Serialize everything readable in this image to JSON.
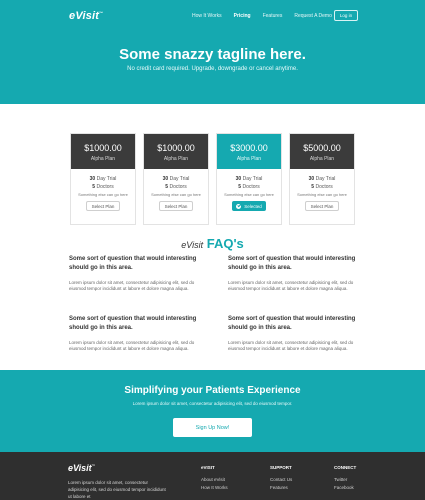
{
  "header": {
    "logo": "eVisit",
    "logo_mark": "™",
    "nav": [
      "How It Works",
      "Pricing",
      "Features",
      "Request A Demo"
    ],
    "active_nav": "Pricing",
    "login_label": "Log in",
    "tagline": "Some snazzy tagline here.",
    "subtagline": "No credit card required. Upgrade, downgrade or cancel anytime.",
    "bg_color": "#15a9b0"
  },
  "plans": [
    {
      "price": "$1000.00",
      "name": "Alpha Plan",
      "trial_num": "30",
      "trial_text": "Day Trial",
      "doctors_num": "5",
      "doctors_text": "Doctors",
      "note": "Something else can go here",
      "button": "Select Plan",
      "featured": false
    },
    {
      "price": "$1000.00",
      "name": "Alpha Plan",
      "trial_num": "30",
      "trial_text": "Day Trial",
      "doctors_num": "5",
      "doctors_text": "Doctors",
      "note": "Something else can go here",
      "button": "Select Plan",
      "featured": false
    },
    {
      "price": "$3000.00",
      "name": "Alpha Plan",
      "trial_num": "30",
      "trial_text": "Day Trial",
      "doctors_num": "5",
      "doctors_text": "Doctors",
      "note": "Something else can go here",
      "button": "Selected",
      "featured": true
    },
    {
      "price": "$5000.00",
      "name": "Alpha Plan",
      "trial_num": "30",
      "trial_text": "Day Trial",
      "doctors_num": "5",
      "doctors_text": "Doctors",
      "note": "Something else can go here",
      "button": "Select Plan",
      "featured": false
    }
  ],
  "faq": {
    "brand": "eVisit",
    "title": "FAQ's",
    "items": [
      {
        "question": "Some sort of question that would interesting should go in this area.",
        "answer": "Lorem ipsum dolor sit amet, consectetur adipisicing elit, sed do eiusmod tempor incididunt ut labore et dolore magna aliqua."
      },
      {
        "question": "Some sort of question that would interesting should go in this area.",
        "answer": "Lorem ipsum dolor sit amet, consectetur adipisicing elit, sed do eiusmod tempor incididunt ut labore et dolore magna aliqua."
      },
      {
        "question": "Some sort of question that would interesting should go in this area.",
        "answer": "Lorem ipsum dolor sit amet, consectetur adipisicing elit, sed do eiusmod tempor incididunt ut labore et dolore magna aliqua."
      },
      {
        "question": "Some sort of question that would interesting should go in this area.",
        "answer": "Lorem ipsum dolor sit amet, consectetur adipisicing elit, sed do eiusmod tempor incididunt ut labore et dolore magna aliqua."
      }
    ]
  },
  "cta": {
    "title": "Simplifying your Patients Experience",
    "text": "Lorem ipsum dolor sit amet, consectetur adipisicing elit, sed do eiusmod tempor.",
    "button": "Sign Up Now!"
  },
  "footer": {
    "logo": "eVisit",
    "about": "Lorem ipsum dolor sit amet, consectetur adipisicing elit, sed do eiusmod tempor incididunt ut labore et",
    "columns": [
      {
        "title": "eVISIT",
        "links": [
          "About eVisit",
          "How It Works"
        ]
      },
      {
        "title": "SUPPORT",
        "links": [
          "Contact Us",
          "Features"
        ]
      },
      {
        "title": "CONNECT",
        "links": [
          "Twitter",
          "Facebook"
        ]
      }
    ]
  }
}
